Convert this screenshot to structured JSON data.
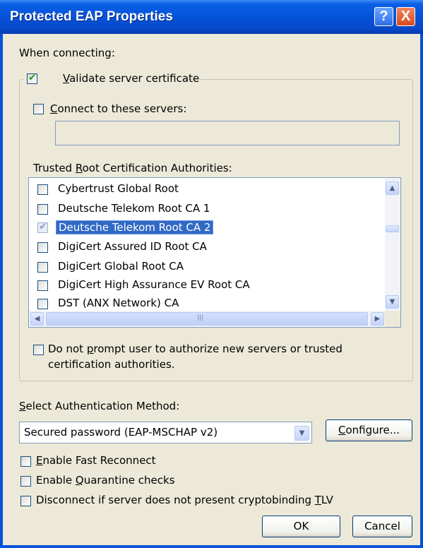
{
  "window": {
    "title": "Protected EAP Properties",
    "help_label": "?",
    "close_label": "X"
  },
  "section": {
    "when_connecting": "When connecting:"
  },
  "validate": {
    "pre": "",
    "accel": "V",
    "post": "alidate server certificate",
    "checked": true
  },
  "connect": {
    "pre": "",
    "accel": "C",
    "post": "onnect to these servers:",
    "value": ""
  },
  "trusted": {
    "pre": "Trusted ",
    "accel": "R",
    "post": "oot Certification Authorities:"
  },
  "ca_list": [
    {
      "label": "Cybertrust Global Root",
      "checked": false,
      "selected": false
    },
    {
      "label": "Deutsche Telekom Root CA 1",
      "checked": false,
      "selected": false
    },
    {
      "label": "Deutsche Telekom Root CA 2",
      "checked": true,
      "selected": true
    },
    {
      "label": "DigiCert Assured ID Root CA",
      "checked": false,
      "selected": false
    },
    {
      "label": "DigiCert Global Root CA",
      "checked": false,
      "selected": false
    },
    {
      "label": "DigiCert High Assurance EV Root CA",
      "checked": false,
      "selected": false
    },
    {
      "label": "DST (ANX Network) CA",
      "checked": false,
      "selected": false
    }
  ],
  "noprompt": {
    "pre": "Do not ",
    "accel": "p",
    "post": "rompt user to authorize new servers or trusted",
    "line2": "certification authorities.",
    "checked": false
  },
  "auth": {
    "pre": "",
    "accel": "S",
    "post": "elect Authentication Method:",
    "selected_value": "Secured password (EAP-MSCHAP v2)"
  },
  "configure": {
    "pre": "",
    "accel": "C",
    "post": "onfigure..."
  },
  "fast": {
    "pre": "",
    "accel": "E",
    "post": "nable Fast Reconnect",
    "checked": false
  },
  "quarantine": {
    "pre": "Enable ",
    "accel": "Q",
    "post": "uarantine checks",
    "checked": false
  },
  "crypto": {
    "pre": "Disconnect if server does not present cryptobinding ",
    "accel": "T",
    "post": "LV",
    "checked": false
  },
  "buttons": {
    "ok": "OK",
    "cancel": "Cancel"
  },
  "icons": {
    "check": "✔",
    "up": "▲",
    "down": "▼",
    "left": "◀",
    "right": "▶",
    "grip": "|||"
  }
}
